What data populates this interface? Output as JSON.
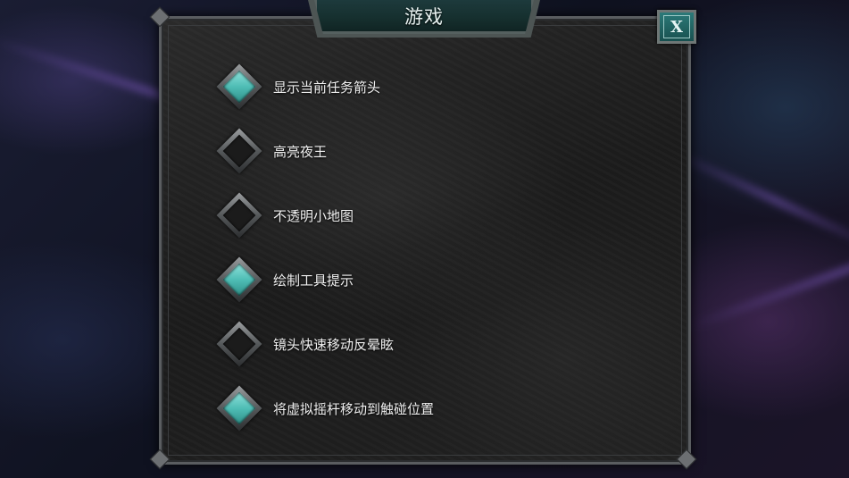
{
  "dialog": {
    "title": "游戏",
    "close_label": "X"
  },
  "options": [
    {
      "label": "显示当前任务箭头",
      "checked": true
    },
    {
      "label": "高亮夜王",
      "checked": false
    },
    {
      "label": "不透明小地图",
      "checked": false
    },
    {
      "label": "绘制工具提示",
      "checked": true
    },
    {
      "label": "镜头快速移动反晕眩",
      "checked": false
    },
    {
      "label": "将虚拟摇杆移动到触碰位置",
      "checked": true
    }
  ],
  "colors": {
    "accent": "#4fbdb5",
    "banner": "#16302f",
    "panel": "#222222"
  },
  "icons": {
    "checkbox_checked": "teal-diamond-icon",
    "checkbox_unchecked": "empty-diamond-icon",
    "close": "close-icon"
  }
}
